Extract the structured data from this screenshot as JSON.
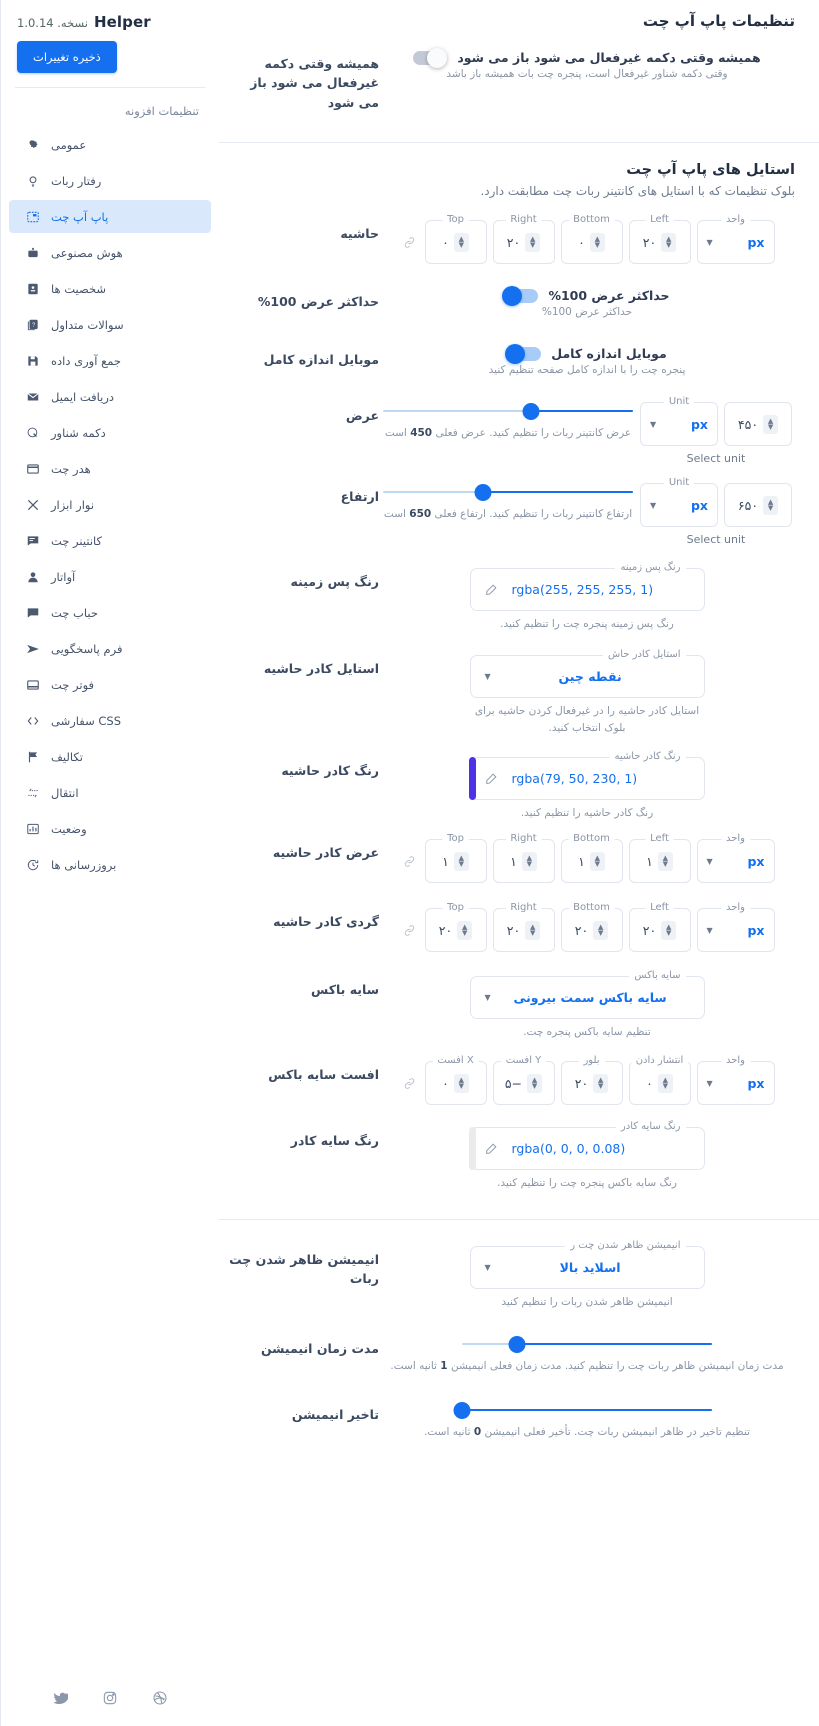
{
  "sidebar": {
    "brand_name": "Helper",
    "brand_version": "نسخه. 1.0.14",
    "save_label": "ذخیره تغییرات",
    "section_title": "تنظیمات افزونه",
    "items": [
      {
        "label": "عمومی",
        "icon": "gear-icon"
      },
      {
        "label": "رفتار ربات",
        "icon": "lightbulb-icon"
      },
      {
        "label": "پاپ آپ چت",
        "icon": "popup-icon"
      },
      {
        "label": "هوش مصنوعی",
        "icon": "robot-icon"
      },
      {
        "label": "شخصیت ها",
        "icon": "id-card-icon"
      },
      {
        "label": "سوالات متداول",
        "icon": "faq-icon"
      },
      {
        "label": "جمع آوری داده",
        "icon": "save-disk-icon"
      },
      {
        "label": "دریافت ایمیل",
        "icon": "envelope-icon"
      },
      {
        "label": "دکمه شناور",
        "icon": "floating-button-icon"
      },
      {
        "label": "هدر چت",
        "icon": "header-icon"
      },
      {
        "label": "نوار ابزار",
        "icon": "tools-icon"
      },
      {
        "label": "کانتینر چت",
        "icon": "chat-container-icon"
      },
      {
        "label": "آواتار",
        "icon": "avatar-icon"
      },
      {
        "label": "حباب چت",
        "icon": "chat-bubble-icon"
      },
      {
        "label": "فرم پاسخگویی",
        "icon": "send-icon"
      },
      {
        "label": "فوتر چت",
        "icon": "footer-icon"
      },
      {
        "label": "CSS سفارشی",
        "icon": "code-icon"
      },
      {
        "label": "تکالیف",
        "icon": "flag-icon"
      },
      {
        "label": "انتقال",
        "icon": "transfer-icon"
      },
      {
        "label": "وضعیت",
        "icon": "stats-icon"
      },
      {
        "label": "بروزرسانی ها",
        "icon": "update-clock-icon"
      }
    ],
    "active_index": 2,
    "footer_icons": [
      "dribbble-icon",
      "instagram-icon",
      "twitter-icon"
    ]
  },
  "main": {
    "page_title": "تنظیمات پاپ آپ چت",
    "always_open": {
      "label": "همیشه وقتی دکمه غیرفعال می شود باز می شود",
      "toggle_label": "همیشه وقتی دکمه غیرفعال می شود باز می شود",
      "hint": "وقتی دکمه شناور غیرفعال است، پنجره چت بات همیشه باز باشد",
      "state": "off"
    },
    "styles_section": {
      "title": "استایل های پاپ آپ چت",
      "subtitle": "بلوک تنظیمات که با استایل های کانتینر ربات چت مطابقت دارد."
    },
    "margin": {
      "label": "حاشیه",
      "unit_legend": "واحد",
      "unit_value": "px",
      "fields": [
        {
          "legend": "Top",
          "value": "۰"
        },
        {
          "legend": "Right",
          "value": "۲۰"
        },
        {
          "legend": "Bottom",
          "value": "۰"
        },
        {
          "legend": "Left",
          "value": "۲۰"
        }
      ]
    },
    "max_width": {
      "label": "حداکثر عرض 100%",
      "toggle_label": "حداکثر عرض 100%",
      "hint": "حداکثر عرض 100%",
      "state": "on"
    },
    "mobile_full": {
      "label": "موبایل اندازه کامل",
      "toggle_label": "موبایل اندازه کامل",
      "hint": "پنجره چت را با اندازه کامل صفحه تنظیم کنید",
      "state": "on"
    },
    "width": {
      "label": "عرض",
      "unit_legend": "Unit",
      "unit_value": "px",
      "select_unit_note": "Select unit",
      "value_legend": "",
      "value": "۴۵۰",
      "hint_prefix": "عرض کانتینر ربات را تنظیم کنید. عرض فعلی",
      "hint_number": "450",
      "hint_suffix": "است",
      "slider_percent": 41
    },
    "height": {
      "label": "ارتفاع",
      "unit_legend": "Unit",
      "unit_value": "px",
      "select_unit_note": "Select unit",
      "value": "۶۵۰",
      "hint_prefix": "ارتفاع کانتینر ربات را تنظیم کنید. ارتفاع فعلی",
      "hint_number": "650",
      "hint_suffix": "است",
      "slider_percent": 60
    },
    "bg_color": {
      "label": "رنگ پس زمینه",
      "legend": "رنگ پس زمینه",
      "value": "rgba(255, 255, 255, 1)",
      "swatch": "#ffffff",
      "hint": "رنگ پس زمینه پنجره چت را تنظیم کنید."
    },
    "border_style": {
      "label": "استایل کادر حاشیه",
      "legend": "استایل کادر حاش",
      "value": "نقطه چین",
      "hint": "استایل کادر حاشیه را در غیرفعال کردن حاشیه برای بلوک انتخاب کنید."
    },
    "border_color": {
      "label": "رنگ کادر حاشیه",
      "legend": "رنگ کادر حاشیه",
      "value": "rgba(79, 50, 230, 1)",
      "swatch": "#4f32e6",
      "hint": "رنگ کادر حاشیه را تنظیم کنید."
    },
    "border_width": {
      "label": "عرض کادر حاشیه",
      "unit_legend": "واحد",
      "unit_value": "px",
      "fields": [
        {
          "legend": "Top",
          "value": "۱"
        },
        {
          "legend": "Right",
          "value": "۱"
        },
        {
          "legend": "Bottom",
          "value": "۱"
        },
        {
          "legend": "Left",
          "value": "۱"
        }
      ]
    },
    "border_radius": {
      "label": "گردی کادر حاشیه",
      "unit_legend": "واحد",
      "unit_value": "px",
      "fields": [
        {
          "legend": "Top",
          "value": "۲۰"
        },
        {
          "legend": "Right",
          "value": "۲۰"
        },
        {
          "legend": "Bottom",
          "value": "۲۰"
        },
        {
          "legend": "Left",
          "value": "۲۰"
        }
      ]
    },
    "box_shadow": {
      "label": "سایه باکس",
      "legend": "سایه باکس",
      "value": "سایه باکس سمت بیرونی",
      "hint": "تنظیم سایه باکس پنجره چت."
    },
    "shadow_offset": {
      "label": "افست سایه باکس",
      "unit_legend": "واحد",
      "unit_value": "px",
      "fields": [
        {
          "legend": "افست X",
          "value": "۰"
        },
        {
          "legend": "افست Y",
          "value": "−۵"
        },
        {
          "legend": "بلور",
          "value": "۲۰"
        },
        {
          "legend": "انتشار دادن",
          "value": "۰"
        }
      ]
    },
    "shadow_color": {
      "label": "رنگ سایه کادر",
      "legend": "رنگ سایه کادر",
      "value": "rgba(0, 0, 0, 0.08)",
      "swatch": "#ebebeb",
      "hint": "رنگ سایه باکس پنجره چت را تنظیم کنید."
    },
    "appear_animation": {
      "label": "انیمیشن ظاهر شدن چت ربات",
      "legend": "انیمیشن ظاهر شدن چت ر",
      "value": "اسلاید بالا",
      "hint": "انیمیشن ظاهر شدن ربات را تنظیم کنید"
    },
    "animation_duration": {
      "label": "مدت زمان انیمیشن",
      "hint_prefix": "مدت زمان انیمیشن ظاهر ربات چت را تنظیم کنید. مدت زمان فعلی انیمیشن",
      "hint_number": "1",
      "hint_suffix": "ثانیه است.",
      "slider_percent": 78
    },
    "animation_delay": {
      "label": "تاخیر انیمیشن",
      "hint_prefix": "تنظیم تاخیر در ظاهر انیمیشن ربات چت. تأخیر فعلی انیمیشن",
      "hint_number": "0",
      "hint_suffix": "ثانیه است.",
      "slider_percent": 100
    }
  },
  "colors": {
    "accent": "#1470ef",
    "sidebar_active_bg": "#d9e9fb",
    "border": "#e1e6ee"
  }
}
